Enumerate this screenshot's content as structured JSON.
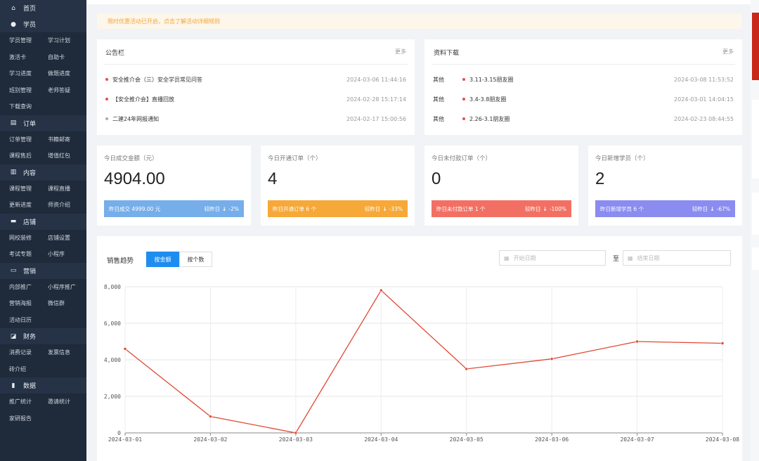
{
  "sidebar": {
    "sections": [
      {
        "icon": "home-icon",
        "glyph": "⌂",
        "label": "首页",
        "active": true,
        "rows": []
      },
      {
        "icon": "user-icon",
        "glyph": "●",
        "label": "学员",
        "rows": [
          [
            "学员管理",
            "学习计划"
          ],
          [
            "激活卡",
            "自助卡"
          ],
          [
            "学习进度",
            "做题进度"
          ],
          [
            "班别管理",
            "老师答疑"
          ],
          [
            "下载查询"
          ]
        ]
      },
      {
        "icon": "order-icon",
        "glyph": "▤",
        "label": "订单",
        "rows": [
          [
            "订单管理",
            "书籍邮寄"
          ],
          [
            "课程售后",
            "增值红包"
          ]
        ]
      },
      {
        "icon": "content-icon",
        "glyph": "▥",
        "label": "内容",
        "rows": [
          [
            "课程管理",
            "课程直播"
          ],
          [
            "更新进度",
            "师资介绍"
          ]
        ]
      },
      {
        "icon": "shop-icon",
        "glyph": "▬",
        "label": "店铺",
        "rows": [
          [
            "网校装修",
            "店铺设置"
          ],
          [
            "考试专题",
            "小程序"
          ]
        ]
      },
      {
        "icon": "ticket-icon",
        "glyph": "▭",
        "label": "营销",
        "rows": [
          [
            "内部推广",
            "小程序推广"
          ],
          [
            "营销海报",
            "微信群"
          ],
          [
            "活动日历"
          ]
        ]
      },
      {
        "icon": "finance-icon",
        "glyph": "◪",
        "label": "财务",
        "rows": [
          [
            "消费记录",
            "发票信息"
          ],
          [
            "砖介绍"
          ]
        ]
      },
      {
        "icon": "data-icon",
        "glyph": "▮",
        "label": "数据",
        "rows": [
          [
            "推广统计",
            "邀请统计"
          ],
          [
            "家研报告"
          ]
        ]
      }
    ]
  },
  "notice": "限时优惠活动已开启，点击了解活动详细规则",
  "bulletin": {
    "title": "公告栏",
    "more": "更多",
    "items": [
      {
        "title": "安全推介会（三）安全学员常见问答",
        "time": "2024-03-06 11:44:16",
        "dot": "red"
      },
      {
        "title": "【安全推介会】直播回放",
        "time": "2024-02-28 15:17:14",
        "dot": "red"
      },
      {
        "title": "二建24年网报通知",
        "time": "2024-02-17 15:00:56",
        "dot": "gray"
      }
    ]
  },
  "downloads": {
    "title": "资料下载",
    "more": "更多",
    "items": [
      {
        "category": "其他",
        "title": "3.11-3.15朋友圈",
        "time": "2024-03-08 11:53:52"
      },
      {
        "category": "其他",
        "title": "3.4-3.8朋友圈",
        "time": "2024-03-01 14:04:15"
      },
      {
        "category": "其他",
        "title": "2.26-3.1朋友圈",
        "time": "2024-02-23 08:44:55"
      }
    ]
  },
  "stats": [
    {
      "label": "今日成交金额（元）",
      "value": "4904.00",
      "sub": "昨日成交 4999.00 元",
      "compare": "较昨日",
      "change": "-2%",
      "color": "#76aeea"
    },
    {
      "label": "今日开通订单（个）",
      "value": "4",
      "sub": "昨日开通订单 6 个",
      "compare": "较昨日",
      "change": "-33%",
      "color": "#f6a838"
    },
    {
      "label": "今日未付款订单（个）",
      "value": "0",
      "sub": "昨日未付款订单 1 个",
      "compare": "较昨日",
      "change": "-100%",
      "color": "#f27063"
    },
    {
      "label": "今日新增学员（个）",
      "value": "2",
      "sub": "昨日新增学员 6 个",
      "compare": "较昨日",
      "change": "-67%",
      "color": "#8b8cf0"
    }
  ],
  "chart_panel": {
    "title": "销售趋势",
    "toggle_active": "按金额",
    "toggle_inactive": "按个数",
    "start_placeholder": "开始日期",
    "end_placeholder": "结束日期",
    "to_label": "至"
  },
  "chart_data": {
    "type": "line",
    "title": "",
    "x": [
      "2024-03-01",
      "2024-03-02",
      "2024-03-03",
      "2024-03-04",
      "2024-03-05",
      "2024-03-06",
      "2024-03-07",
      "2024-03-08"
    ],
    "series": [
      {
        "values": [
          4600,
          900,
          0,
          7800,
          3500,
          4050,
          5000,
          4904
        ]
      }
    ],
    "y_ticks": [
      "0",
      "2,000",
      "4,000",
      "6,000",
      "8,000"
    ],
    "ylim": [
      0,
      8000
    ],
    "grid": true,
    "color": "#e14936"
  }
}
